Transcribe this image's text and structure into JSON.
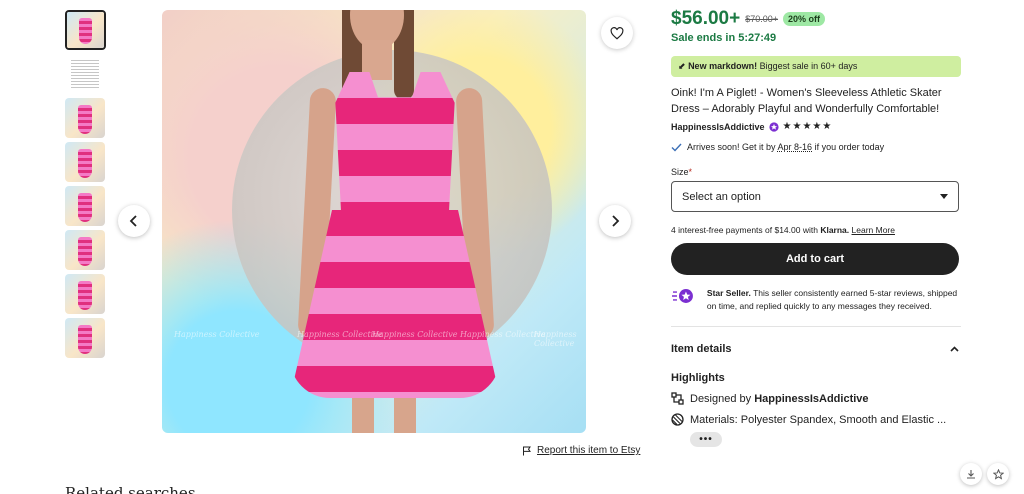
{
  "gallery": {
    "thumbnails": [
      {
        "kind": "dress",
        "active": true
      },
      {
        "kind": "size-chart",
        "active": false
      },
      {
        "kind": "dress",
        "active": false
      },
      {
        "kind": "dress",
        "active": false
      },
      {
        "kind": "dress",
        "active": false
      },
      {
        "kind": "dress",
        "active": false
      },
      {
        "kind": "dress",
        "active": false
      },
      {
        "kind": "dress",
        "active": false
      }
    ],
    "watermark_text": "Happiness Collective"
  },
  "report_link": "Report this item to Etsy",
  "related_heading": "Related searches",
  "product": {
    "price": "$56.00+",
    "original_price": "$70.00+",
    "discount": "20% off",
    "sale_ends": "Sale ends in 5:27:49",
    "markdown_bold": "New markdown!",
    "markdown_rest": " Biggest sale in 60+ days",
    "title": "Oink! I'm A Piglet! - Women's Sleeveless Athletic Skater Dress – Adorably Playful and Wonderfully Comfortable!",
    "seller": "HappinessIsAddictive",
    "stars": "★★★★★",
    "arrives_prefix": "Arrives soon! Get it by ",
    "arrives_dates": "Apr 8-16",
    "arrives_suffix": " if you order today",
    "size_label": "Size",
    "size_required": "*",
    "size_placeholder": "Select an option",
    "klarna_prefix": "4 interest-free payments of $14.00 with ",
    "klarna_brand": "Klarna.",
    "klarna_link": "Learn More",
    "add_to_cart": "Add to cart",
    "star_seller_bold": "Star Seller.",
    "star_seller_text": " This seller consistently earned 5-star reviews, shipped on time, and replied quickly to any messages they received.",
    "item_details": "Item details",
    "highlights_heading": "Highlights",
    "designed_by_prefix": "Designed by ",
    "designed_by_name": "HappinessIsAddictive",
    "materials": "Materials: Polyester Spandex, Smooth and Elastic ...",
    "more": "•••"
  },
  "colors": {
    "sale_green": "#1b7a43",
    "discount_bg": "#9ee8a4",
    "markdown_bg": "#cfeea0",
    "button_dark": "#222222",
    "star_seller_purple": "#7b2fd1"
  },
  "icons": [
    "heart-icon",
    "chevron-left-icon",
    "chevron-right-icon",
    "flag-icon",
    "checkmark-icon",
    "caret-down-icon",
    "chevron-up-icon",
    "design-icon",
    "materials-icon",
    "star-seller-badge-icon",
    "download-icon",
    "star-icon",
    "tag-icon"
  ]
}
